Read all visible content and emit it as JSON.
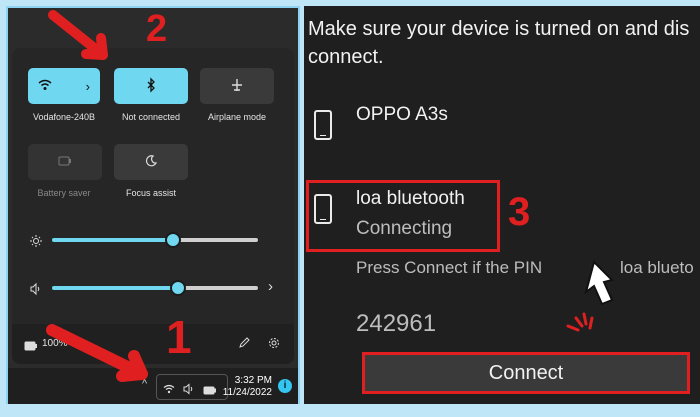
{
  "quick_settings": {
    "tiles": [
      {
        "label": "Vodafone-240B",
        "state": "on",
        "icon": "wifi-icon"
      },
      {
        "label": "Not connected",
        "state": "on",
        "icon": "bluetooth-icon"
      },
      {
        "label": "Airplane mode",
        "state": "off",
        "icon": "airplane-icon"
      },
      {
        "label": "Battery saver",
        "state": "disabled",
        "icon": "battery-saver-icon"
      },
      {
        "label": "Focus assist",
        "state": "off",
        "icon": "moon-icon"
      }
    ],
    "brightness_level": 0.58,
    "volume_level": 0.6,
    "battery_text": "100%"
  },
  "taskbar": {
    "time": "3:32 PM",
    "date": "11/24/2022",
    "info_badge": "i"
  },
  "annotations": {
    "step1": "1",
    "step2": "2",
    "step3": "3"
  },
  "bluetooth_dialog": {
    "intro_line1": "Make sure your device is turned on and dis",
    "intro_line2": "connect.",
    "devices": [
      {
        "name": "OPPO A3s",
        "status": ""
      },
      {
        "name": "loa bluetooth",
        "status": "Connecting"
      }
    ],
    "pin_prompt": "Press Connect if the PIN",
    "pin_prompt_tail": "loa blueto",
    "pin": "242961",
    "connect_label": "Connect"
  },
  "colors": {
    "accent": "#6fd7ef",
    "annotation_red": "#e02020",
    "border_blue": "#8fd3f3"
  }
}
